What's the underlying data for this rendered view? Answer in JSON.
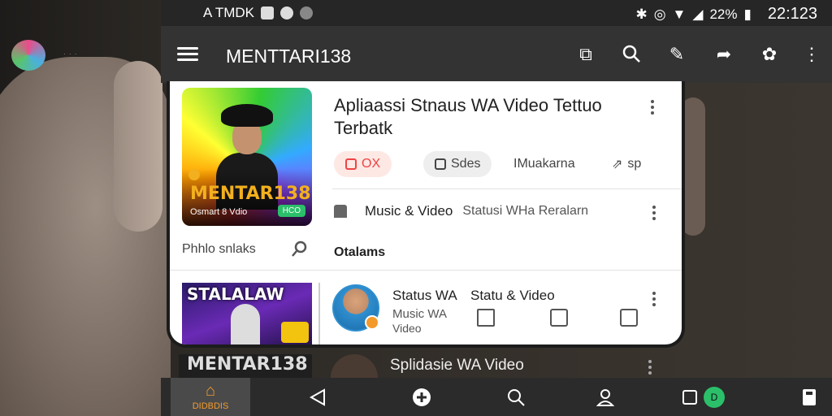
{
  "status_bar": {
    "left_text": "A TMDK",
    "battery": "22%",
    "time": "22:123"
  },
  "app_bar": {
    "title": "MENTTARI138"
  },
  "featured": {
    "brand": "MENTAR138",
    "caption": "Osmart 8 Vdio",
    "badge": "HCO",
    "title": "Apliaassi Stnaus WA Video Tettuo Terbatk",
    "chips": {
      "ox": "OX",
      "sdes": "Sdes",
      "muakarna": "IMuakarna",
      "sp": "sp"
    },
    "category": {
      "title": "Music & Video",
      "subtitle": "Statusi WHa Reralarn"
    }
  },
  "sidebar": {
    "search_label": "Phhlo snlaks"
  },
  "section": {
    "heading": "Otalams"
  },
  "item2": {
    "thumb_title": "STALALAW",
    "title_a": "Status WA",
    "title_b": "Statu & Video",
    "sub1": "Music WA",
    "sub2": "Video"
  },
  "item3": {
    "thumb_title": "MENTAR138",
    "title": "Splidasie WA Video"
  },
  "bottom_nav": {
    "home_label": "DIDBDIS",
    "green_badge": "D"
  },
  "colors": {
    "accent": "#f39a2b",
    "green": "#2bbf6a",
    "red": "#e44444"
  }
}
